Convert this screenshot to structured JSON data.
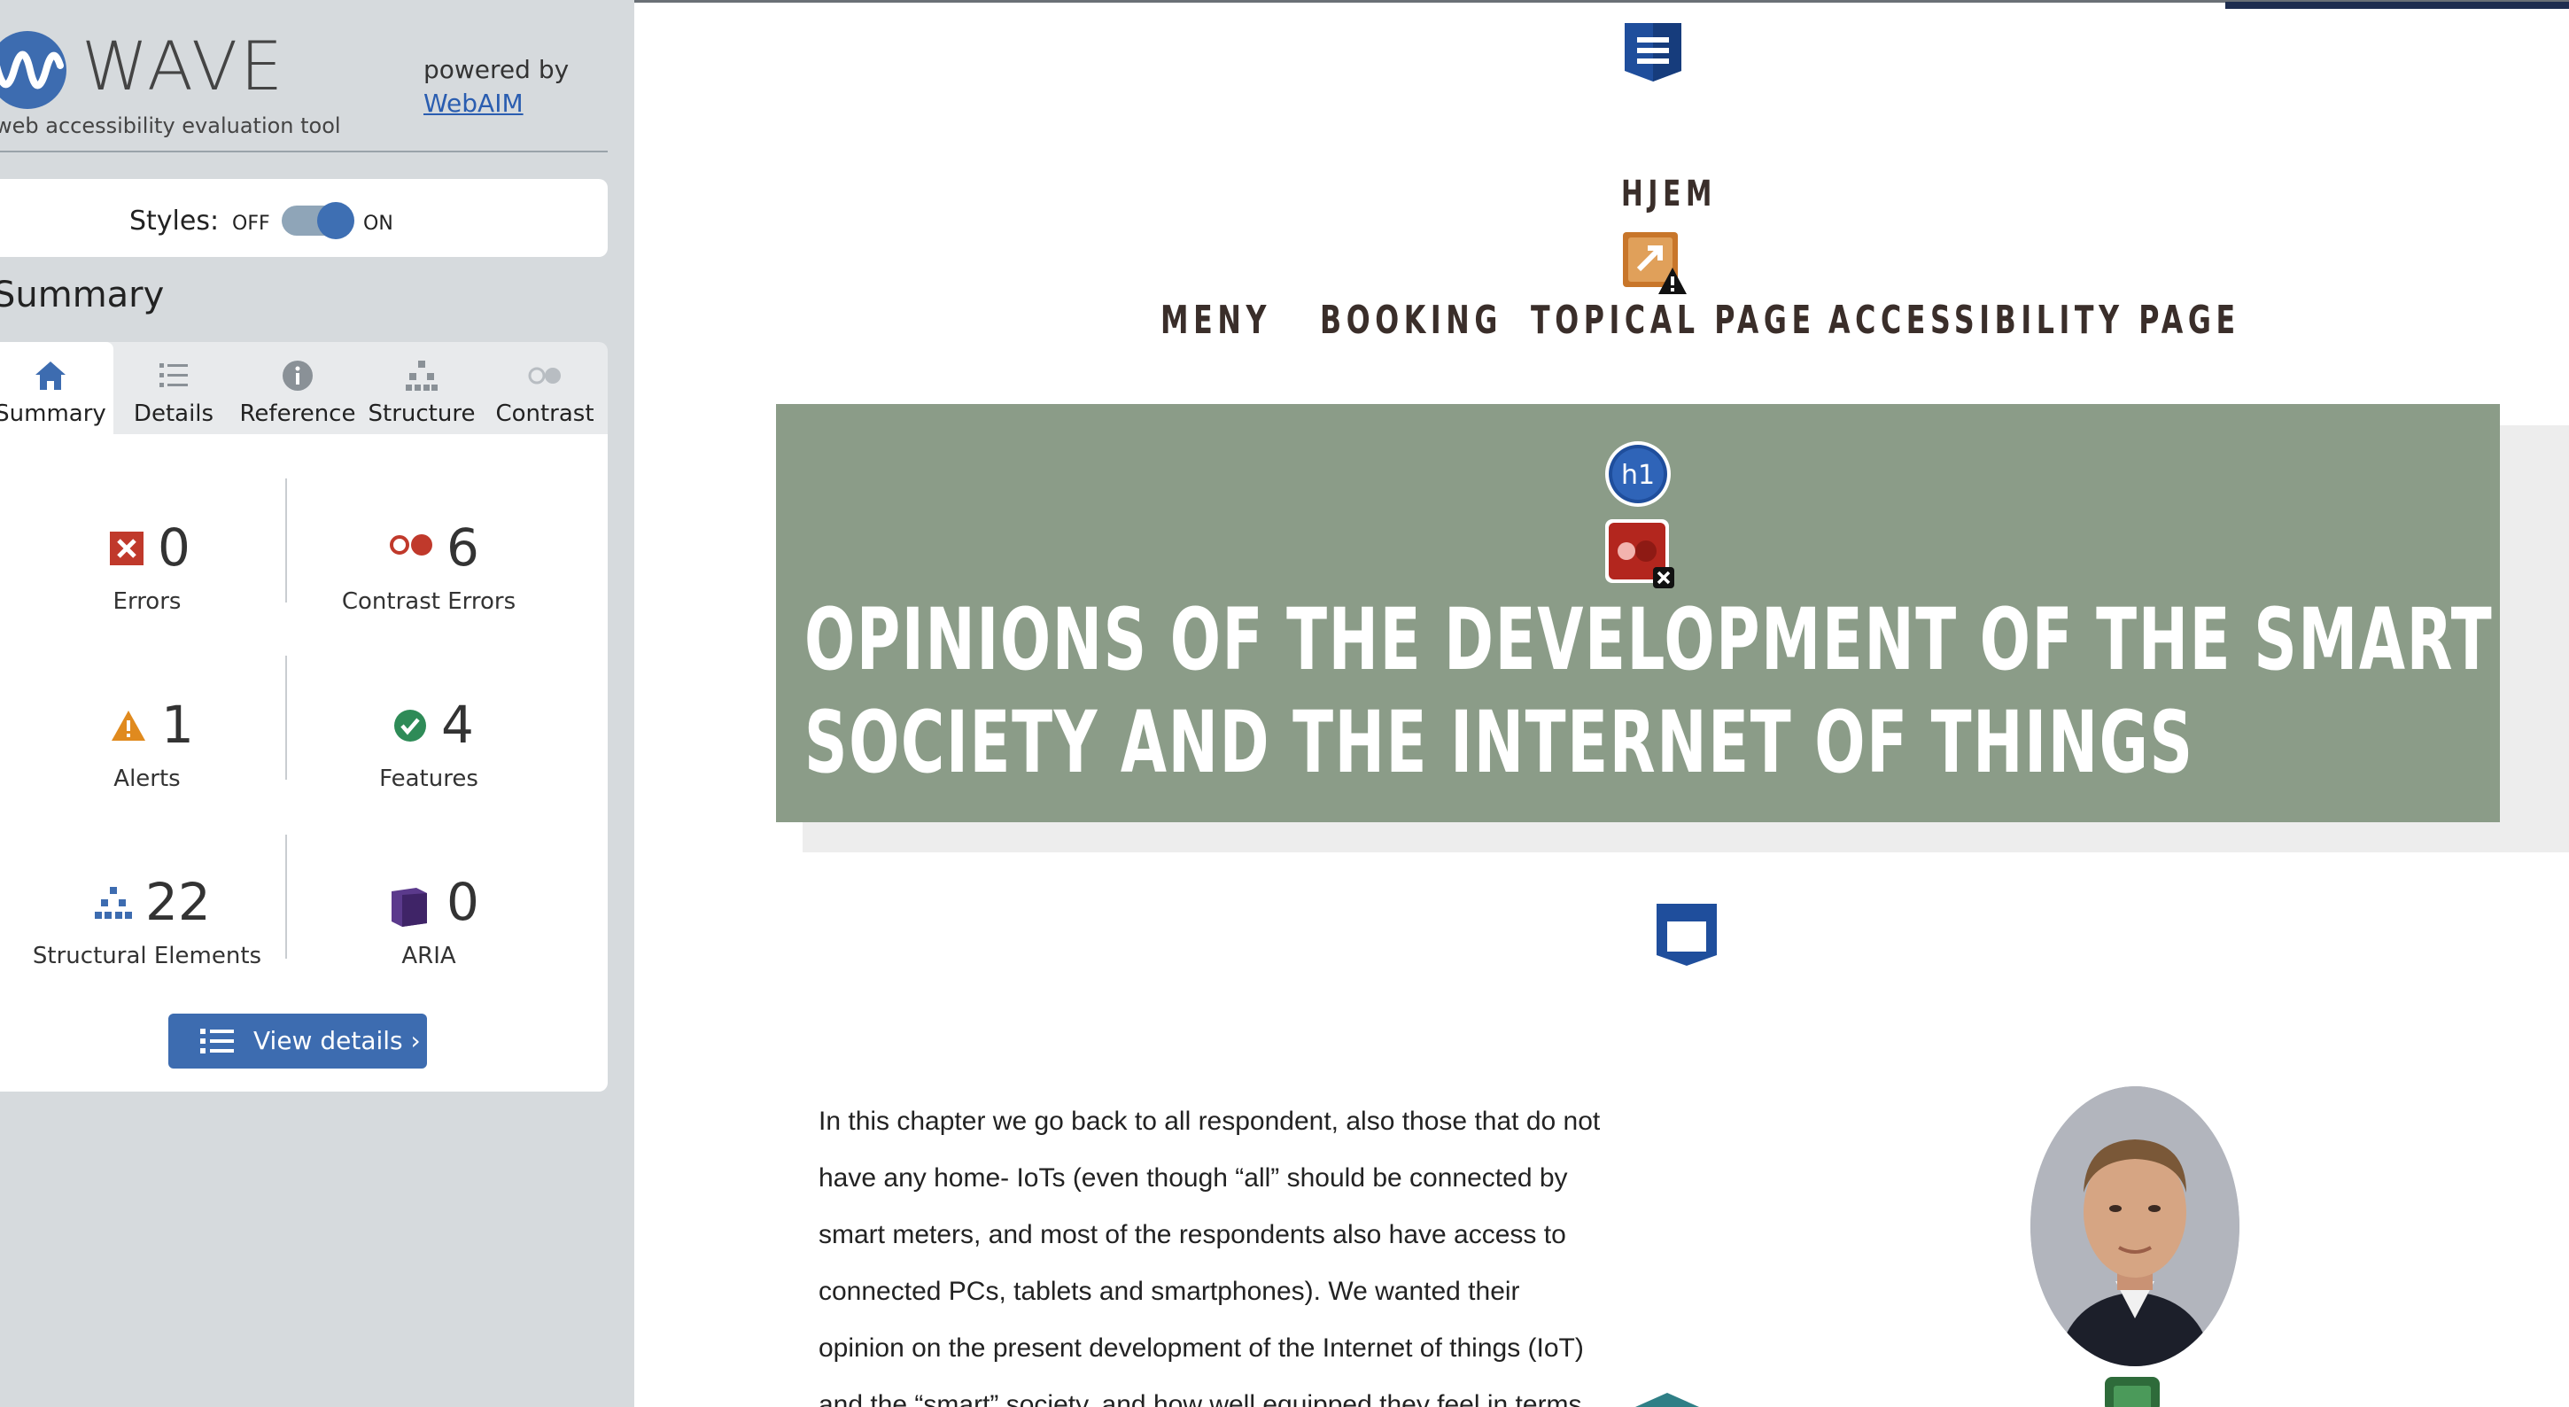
{
  "wave": {
    "title": "WAVE",
    "subtitle": "web accessibility evaluation tool",
    "powered_by": "powered by",
    "webaim_link": "WebAIM",
    "styles_label": "Styles:",
    "styles_off": "OFF",
    "styles_on": "ON",
    "styles_enabled": true,
    "section_heading": "Summary",
    "tabs": [
      {
        "label": "Summary",
        "icon": "home-icon",
        "active": true
      },
      {
        "label": "Details",
        "icon": "list-icon",
        "active": false
      },
      {
        "label": "Reference",
        "icon": "info-icon",
        "active": false
      },
      {
        "label": "Structure",
        "icon": "hierarchy-icon",
        "active": false
      },
      {
        "label": "Contrast",
        "icon": "contrast-icon",
        "active": false
      }
    ],
    "stats": {
      "errors": {
        "count": "0",
        "label": "Errors"
      },
      "contrast_errors": {
        "count": "6",
        "label": "Contrast Errors"
      },
      "alerts": {
        "count": "1",
        "label": "Alerts"
      },
      "features": {
        "count": "4",
        "label": "Features"
      },
      "structural": {
        "count": "22",
        "label": "Structural Elements"
      },
      "aria": {
        "count": "0",
        "label": "ARIA"
      }
    },
    "view_details": "View details ›",
    "colors": {
      "sidebar_bg": "#d6dadd",
      "accent": "#3d6cb0",
      "error": "#c0392b",
      "alert": "#e08a1e",
      "feature": "#2e8b57",
      "aria": "#5b3a8c"
    }
  },
  "page": {
    "home_link": "HJEM",
    "nav": [
      "MENY",
      "BOOKING",
      "TOPICAL PAGE",
      "ACCESSIBILITY PAGE"
    ],
    "hero_title_line1": "OPINIONS OF THE DEVELOPMENT OF THE SMART",
    "hero_title_line2": "SOCIETY AND THE INTERNET OF THINGS",
    "body_lines": [
      "In this chapter we go back to all respondent, also those that do not",
      "have any home- IoTs (even though “all” should be connected by",
      "smart meters, and most of the respondents also have access to",
      "connected PCs, tablets and smartphones). We wanted their",
      "opinion on the present development of the Internet of things (IoT)",
      "and the “smart” society, and how well equipped they feel in terms"
    ],
    "hero_color": "#8b9c88",
    "overlay_icons": [
      "header-region-icon",
      "link-alert-icon",
      "h1-heading-icon",
      "contrast-error-icon",
      "main-region-icon",
      "image-alt-icon"
    ],
    "h1_badge": "h1"
  }
}
